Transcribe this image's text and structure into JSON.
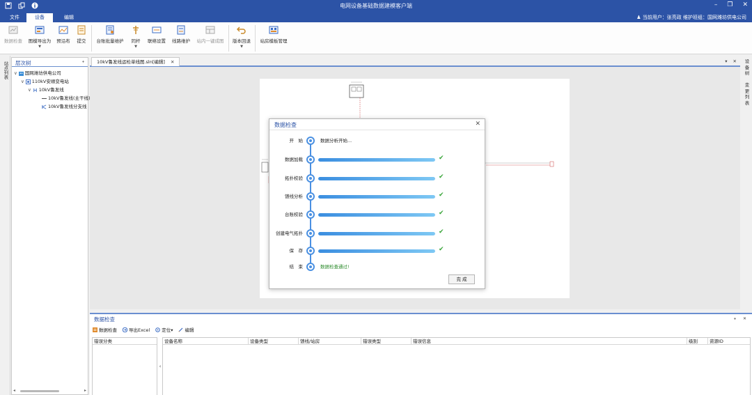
{
  "app": {
    "title": "电网设备基础数据建模客户端"
  },
  "window_controls": {
    "minimize": "–",
    "restore": "❐",
    "close": "✕"
  },
  "ribbon_tabs": [
    {
      "label": "文件",
      "active": false
    },
    {
      "label": "设备",
      "active": true
    },
    {
      "label": "编辑",
      "active": false
    }
  ],
  "user_info": "当前用户：张亮政 维护班组：国网潍坊供电公司",
  "ribbon": [
    {
      "label": "数据检查",
      "icon": "data-check-icon",
      "disabled": true,
      "dropdown": false
    },
    {
      "label": "图模导出为",
      "icon": "export-icon",
      "disabled": false,
      "dropdown": true
    },
    {
      "label": "预沿布",
      "icon": "preview-icon",
      "disabled": false,
      "dropdown": false
    },
    {
      "label": "提交",
      "icon": "submit-icon",
      "disabled": false,
      "dropdown": false
    },
    {
      "label": "台账批量维护",
      "icon": "ledger-icon",
      "disabled": false,
      "dropdown": false
    },
    {
      "label": "同杆",
      "icon": "pole-icon",
      "disabled": false,
      "dropdown": true
    },
    {
      "label": "联络设置",
      "icon": "contact-icon",
      "disabled": false,
      "dropdown": false
    },
    {
      "label": "线路维护",
      "icon": "line-icon",
      "disabled": false,
      "dropdown": false
    },
    {
      "label": "站内一键成图",
      "icon": "diagram-icon",
      "disabled": true,
      "dropdown": false
    },
    {
      "label": "版本回退",
      "icon": "rollback-icon",
      "disabled": false,
      "dropdown": true
    },
    {
      "label": "站房模板管理",
      "icon": "template-icon",
      "disabled": false,
      "dropdown": false
    }
  ],
  "left_strip": "站点列表",
  "tree": {
    "title": "层次树",
    "pin": "ᚐ",
    "nodes": [
      {
        "label": "国网潍坊供电公司",
        "expand": "∨"
      },
      {
        "label": "110kV安顺变电站",
        "expand": "∨"
      },
      {
        "label": "10kV鲁发线",
        "expand": "∨"
      },
      {
        "label": "10kV鲁发线(主干线)",
        "expand": ""
      },
      {
        "label": "10kV鲁发线分支线",
        "expand": ""
      }
    ]
  },
  "doc_tab": {
    "label": "10kV鲁发线运检单线图.sln[编辑]",
    "close": "✕"
  },
  "doc_controls": {
    "dropdown": "▾",
    "close": "✕"
  },
  "right_strip": [
    "设",
    "备",
    "树",
    "",
    "变",
    "更",
    "列",
    "表"
  ],
  "dialog": {
    "title": "数据检查",
    "close": "✕",
    "steps": [
      {
        "label": "开　始",
        "type": "message",
        "message": "数据分析开始...",
        "green": false
      },
      {
        "label": "数据加载",
        "type": "progress",
        "progress": 1.0,
        "ok": true
      },
      {
        "label": "拓扑校验",
        "type": "progress",
        "progress": 1.0,
        "ok": true
      },
      {
        "label": "馈线分析",
        "type": "progress",
        "progress": 1.0,
        "ok": true
      },
      {
        "label": "台账校验",
        "type": "progress",
        "progress": 1.0,
        "ok": true
      },
      {
        "label": "创建电气拓扑",
        "type": "progress",
        "progress": 1.0,
        "ok": true
      },
      {
        "label": "保　存",
        "type": "progress",
        "progress": 1.0,
        "ok": true
      },
      {
        "label": "结　束",
        "type": "message",
        "message": "数据检查通过!",
        "green": true
      }
    ],
    "ok_mark": "✔",
    "done_button": "完 成"
  },
  "bottom": {
    "title": "数据检查",
    "controls": {
      "pin": "ᚐ",
      "close": "✕"
    },
    "toolbar": [
      {
        "label": "数据检查",
        "icon": "data-check-icon"
      },
      {
        "label": "导出Excel",
        "icon": "excel-icon"
      },
      {
        "label": "定位▾",
        "icon": "locate-icon"
      },
      {
        "label": "编辑",
        "icon": "edit-icon"
      }
    ],
    "error_category_header": "错误分类",
    "splitter": "‹",
    "columns": [
      "设备名称",
      "设备类型",
      "馈线/站房",
      "错误类型",
      "错误信息",
      "级别",
      "资源ID"
    ]
  },
  "colors": {
    "accent": "#2c53a6",
    "progress": "#4a90e2",
    "ok": "#3aa53a"
  }
}
